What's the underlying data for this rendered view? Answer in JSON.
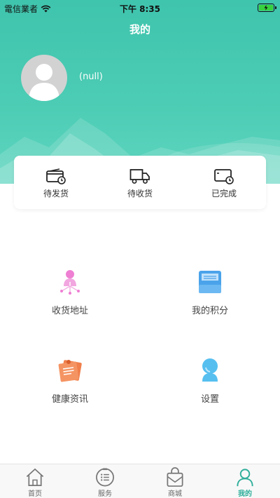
{
  "status_bar": {
    "carrier": "電信業者",
    "time": "下午 8:35"
  },
  "header": {
    "title": "我的"
  },
  "profile": {
    "username": "(null)"
  },
  "orders": [
    {
      "label": "待发货",
      "icon": "wallet-clock-icon"
    },
    {
      "label": "待收货",
      "icon": "truck-icon"
    },
    {
      "label": "已完成",
      "icon": "card-clock-icon"
    }
  ],
  "grid": [
    {
      "label": "收货地址",
      "icon": "address-person-icon"
    },
    {
      "label": "我的积分",
      "icon": "points-tray-icon"
    },
    {
      "label": "健康资讯",
      "icon": "health-note-icon"
    },
    {
      "label": "设置",
      "icon": "settings-person-icon"
    }
  ],
  "tabbar": [
    {
      "label": "首页",
      "icon": "home-icon",
      "active": false
    },
    {
      "label": "服务",
      "icon": "service-list-icon",
      "active": false
    },
    {
      "label": "商城",
      "icon": "shopping-bag-icon",
      "active": false
    },
    {
      "label": "我的",
      "icon": "user-icon",
      "active": true
    }
  ],
  "colors": {
    "accent": "#4cccb4",
    "tab_active": "#2eae9a",
    "battery": "#37d13f"
  }
}
